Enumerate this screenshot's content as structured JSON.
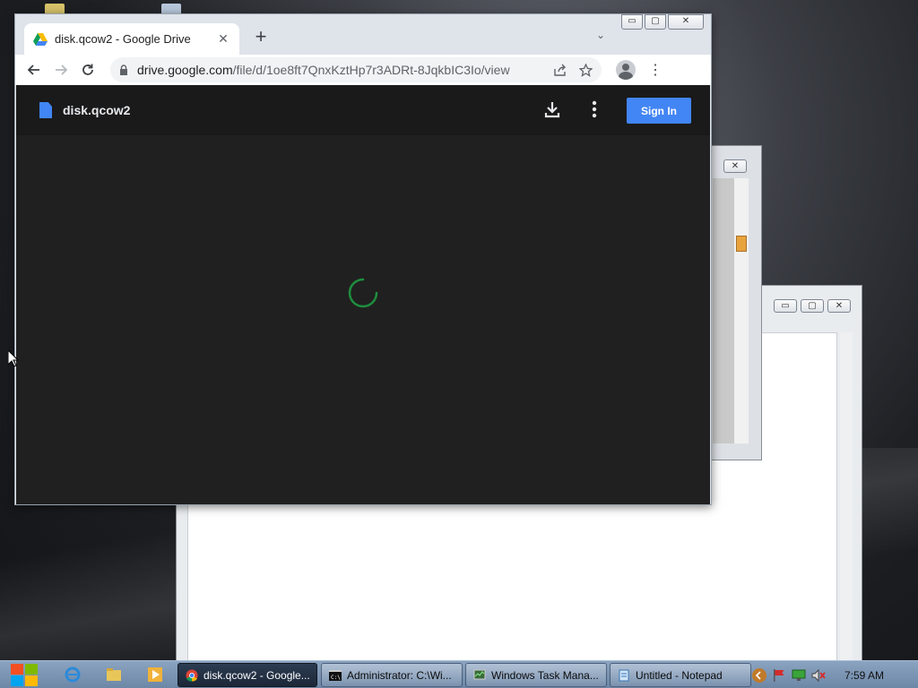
{
  "browser": {
    "tab_title": "disk.qcow2 - Google Drive",
    "url_host": "drive.google.com",
    "url_path": "/file/d/1oe8ft7QnxKztHp7r3ADRt-8JqkbIC3Io/view",
    "new_tab": "+",
    "window_controls": {
      "minimize": "▭",
      "maximize": "▢",
      "close": "✕"
    }
  },
  "drive_viewer": {
    "file_name": "disk.qcow2",
    "sign_in_label": "Sign In",
    "spinner_color": "#1e8e3e",
    "accent": "#4285f4"
  },
  "taskbar": {
    "tasks": [
      {
        "label": "disk.qcow2 - Google...",
        "icon": "chrome-icon",
        "active": true
      },
      {
        "label": "Administrator: C:\\Wi...",
        "icon": "cmd-icon",
        "active": false
      },
      {
        "label": "Windows Task Mana...",
        "icon": "task-manager-icon",
        "active": false
      },
      {
        "label": "Untitled - Notepad",
        "icon": "notepad-icon",
        "active": false
      }
    ],
    "clock": "7:59 AM"
  }
}
